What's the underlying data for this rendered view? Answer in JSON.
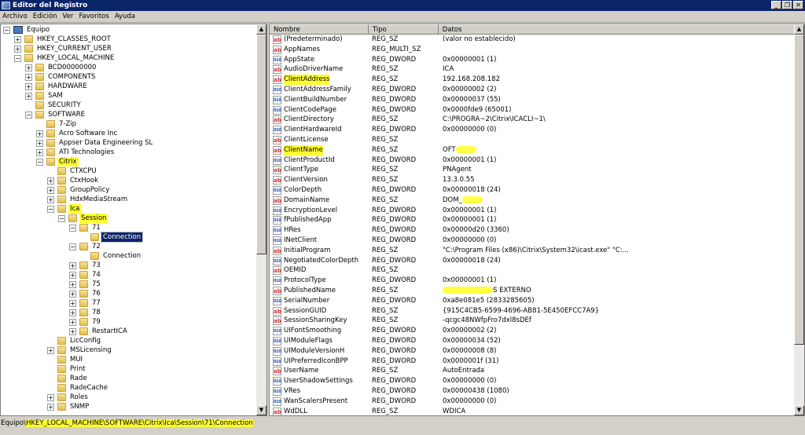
{
  "window": {
    "title": "Editor del Registro",
    "controls": [
      "minimize",
      "restore",
      "close"
    ]
  },
  "menu": [
    "Archivo",
    "Edición",
    "Ver",
    "Favoritos",
    "Ayuda"
  ],
  "colors": {
    "title_bg": "#0a246a",
    "highlight": "#ffff33",
    "selection": "#0a246a"
  },
  "tree": [
    {
      "label": "Equipo",
      "level": 0,
      "expander": "minus",
      "icon": "computer-icon"
    },
    {
      "label": "HKEY_CLASSES_ROOT",
      "level": 1,
      "expander": "plus"
    },
    {
      "label": "HKEY_CURRENT_USER",
      "level": 1,
      "expander": "plus"
    },
    {
      "label": "HKEY_LOCAL_MACHINE",
      "level": 1,
      "expander": "minus"
    },
    {
      "label": "BCD00000000",
      "level": 2,
      "expander": "plus"
    },
    {
      "label": "COMPONENTS",
      "level": 2,
      "expander": "plus"
    },
    {
      "label": "HARDWARE",
      "level": 2,
      "expander": "plus"
    },
    {
      "label": "SAM",
      "level": 2,
      "expander": "plus"
    },
    {
      "label": "SECURITY",
      "level": 2,
      "expander": "none"
    },
    {
      "label": "SOFTWARE",
      "level": 2,
      "expander": "minus"
    },
    {
      "label": "7-Zip",
      "level": 3,
      "expander": "none"
    },
    {
      "label": "Acro Software Inc",
      "level": 3,
      "expander": "plus"
    },
    {
      "label": "Appser Data Engineering SL",
      "level": 3,
      "expander": "plus"
    },
    {
      "label": "ATI Technologies",
      "level": 3,
      "expander": "plus"
    },
    {
      "label": "Citrix",
      "level": 3,
      "expander": "minus",
      "highlight": true
    },
    {
      "label": "CTXCPU",
      "level": 4,
      "expander": "none"
    },
    {
      "label": "CtxHook",
      "level": 4,
      "expander": "plus"
    },
    {
      "label": "GroupPolicy",
      "level": 4,
      "expander": "plus"
    },
    {
      "label": "HdxMediaStream",
      "level": 4,
      "expander": "plus"
    },
    {
      "label": "Ica",
      "level": 4,
      "expander": "minus",
      "highlight": true
    },
    {
      "label": "Session",
      "level": 5,
      "expander": "minus",
      "highlight": true
    },
    {
      "label": "71",
      "level": 6,
      "expander": "minus"
    },
    {
      "label": "Connection",
      "level": 7,
      "expander": "none",
      "selected": true
    },
    {
      "label": "72",
      "level": 6,
      "expander": "minus"
    },
    {
      "label": "Connection",
      "level": 7,
      "expander": "none"
    },
    {
      "label": "73",
      "level": 6,
      "expander": "plus"
    },
    {
      "label": "74",
      "level": 6,
      "expander": "plus"
    },
    {
      "label": "75",
      "level": 6,
      "expander": "plus"
    },
    {
      "label": "76",
      "level": 6,
      "expander": "plus"
    },
    {
      "label": "77",
      "level": 6,
      "expander": "plus"
    },
    {
      "label": "78",
      "level": 6,
      "expander": "plus"
    },
    {
      "label": "79",
      "level": 6,
      "expander": "plus"
    },
    {
      "label": "RestartICA",
      "level": 6,
      "expander": "plus"
    },
    {
      "label": "LicConfig",
      "level": 4,
      "expander": "none"
    },
    {
      "label": "MSLicensing",
      "level": 4,
      "expander": "plus"
    },
    {
      "label": "MUI",
      "level": 4,
      "expander": "none"
    },
    {
      "label": "Print",
      "level": 4,
      "expander": "none"
    },
    {
      "label": "Rade",
      "level": 4,
      "expander": "none"
    },
    {
      "label": "RadeCache",
      "level": 4,
      "expander": "none"
    },
    {
      "label": "Roles",
      "level": 4,
      "expander": "plus"
    },
    {
      "label": "SNMP",
      "level": 4,
      "expander": "plus"
    }
  ],
  "list": {
    "columns": [
      "Nombre",
      "Tipo",
      "Datos"
    ],
    "rows": [
      {
        "name": "(Predeterminado)",
        "type": "REG_SZ",
        "data": "(valor no establecido)"
      },
      {
        "name": "AppNames",
        "type": "REG_MULTI_SZ",
        "data": ""
      },
      {
        "name": "AppState",
        "type": "REG_DWORD",
        "data": "0x00000001 (1)"
      },
      {
        "name": "AudioDriverName",
        "type": "REG_SZ",
        "data": "ICA"
      },
      {
        "name": "ClientAddress",
        "type": "REG_SZ",
        "data": "192.168.208.182",
        "highlight": true
      },
      {
        "name": "ClientAddressFamily",
        "type": "REG_DWORD",
        "data": "0x00000002 (2)"
      },
      {
        "name": "ClientBuildNumber",
        "type": "REG_DWORD",
        "data": "0x00000037 (55)"
      },
      {
        "name": "ClientCodePage",
        "type": "REG_DWORD",
        "data": "0x0000fde9 (65001)"
      },
      {
        "name": "ClientDirectory",
        "type": "REG_SZ",
        "data": "C:\\PROGRA~2\\Citrix\\ICACLI~1\\"
      },
      {
        "name": "ClientHardwareId",
        "type": "REG_DWORD",
        "data": "0x00000000 (0)"
      },
      {
        "name": "ClientLicense",
        "type": "REG_SZ",
        "data": ""
      },
      {
        "name": "ClientName",
        "type": "REG_SZ",
        "data": "OFT",
        "highlight": true,
        "redacted_after": true
      },
      {
        "name": "ClientProductId",
        "type": "REG_DWORD",
        "data": "0x00000001 (1)"
      },
      {
        "name": "ClientType",
        "type": "REG_SZ",
        "data": "PNAgent"
      },
      {
        "name": "ClientVersion",
        "type": "REG_SZ",
        "data": "13.3.0.55"
      },
      {
        "name": "ColorDepth",
        "type": "REG_DWORD",
        "data": "0x00000018 (24)"
      },
      {
        "name": "DomainName",
        "type": "REG_SZ",
        "data": "DOM_",
        "redacted_after": true
      },
      {
        "name": "EncryptionLevel",
        "type": "REG_DWORD",
        "data": "0x00000001 (1)"
      },
      {
        "name": "fPublishedApp",
        "type": "REG_DWORD",
        "data": "0x00000001 (1)"
      },
      {
        "name": "HRes",
        "type": "REG_DWORD",
        "data": "0x00000d20 (3360)"
      },
      {
        "name": "INetClient",
        "type": "REG_DWORD",
        "data": "0x00000000 (0)"
      },
      {
        "name": "InitialProgram",
        "type": "REG_SZ",
        "data": "\"C:\\Program Files (x86)\\Citrix\\System32\\icast.exe\" \"C:..."
      },
      {
        "name": "NegotiatedColorDepth",
        "type": "REG_DWORD",
        "data": "0x00000018 (24)"
      },
      {
        "name": "OEMID",
        "type": "REG_SZ",
        "data": ""
      },
      {
        "name": "ProtocolType",
        "type": "REG_DWORD",
        "data": "0x00000001 (1)"
      },
      {
        "name": "PublishedName",
        "type": "REG_SZ",
        "data": "S EXTERNO",
        "redacted_before": true
      },
      {
        "name": "SerialNumber",
        "type": "REG_DWORD",
        "data": "0xa8e081e5 (2833285605)"
      },
      {
        "name": "SessionGUID",
        "type": "REG_SZ",
        "data": "{915C4CB5-6599-4696-AB81-5E450EFCC7A9}"
      },
      {
        "name": "SessionSharingKey",
        "type": "REG_SZ",
        "data": "-qcgc48NWfpFro7dxl8sDEf"
      },
      {
        "name": "UIFontSmoothing",
        "type": "REG_DWORD",
        "data": "0x00000002 (2)"
      },
      {
        "name": "UIModuleFlags",
        "type": "REG_DWORD",
        "data": "0x00000034 (52)"
      },
      {
        "name": "UIModuleVersionH",
        "type": "REG_DWORD",
        "data": "0x00000008 (8)"
      },
      {
        "name": "UIPreferredIconBPP",
        "type": "REG_DWORD",
        "data": "0x0000001f (31)"
      },
      {
        "name": "UserName",
        "type": "REG_SZ",
        "data": "AutoEntrada"
      },
      {
        "name": "UserShadowSettings",
        "type": "REG_DWORD",
        "data": "0x00000000 (0)"
      },
      {
        "name": "VRes",
        "type": "REG_DWORD",
        "data": "0x00000438 (1080)"
      },
      {
        "name": "WanScalersPresent",
        "type": "REG_DWORD",
        "data": "0x00000000 (0)"
      },
      {
        "name": "WdDLL",
        "type": "REG_SZ",
        "data": "WDICA"
      }
    ]
  },
  "status": {
    "prefix": "Equipo\\",
    "path": "HKEY_LOCAL_MACHINE\\SOFTWARE\\Citrix\\Ica\\Session\\71\\Connection"
  }
}
